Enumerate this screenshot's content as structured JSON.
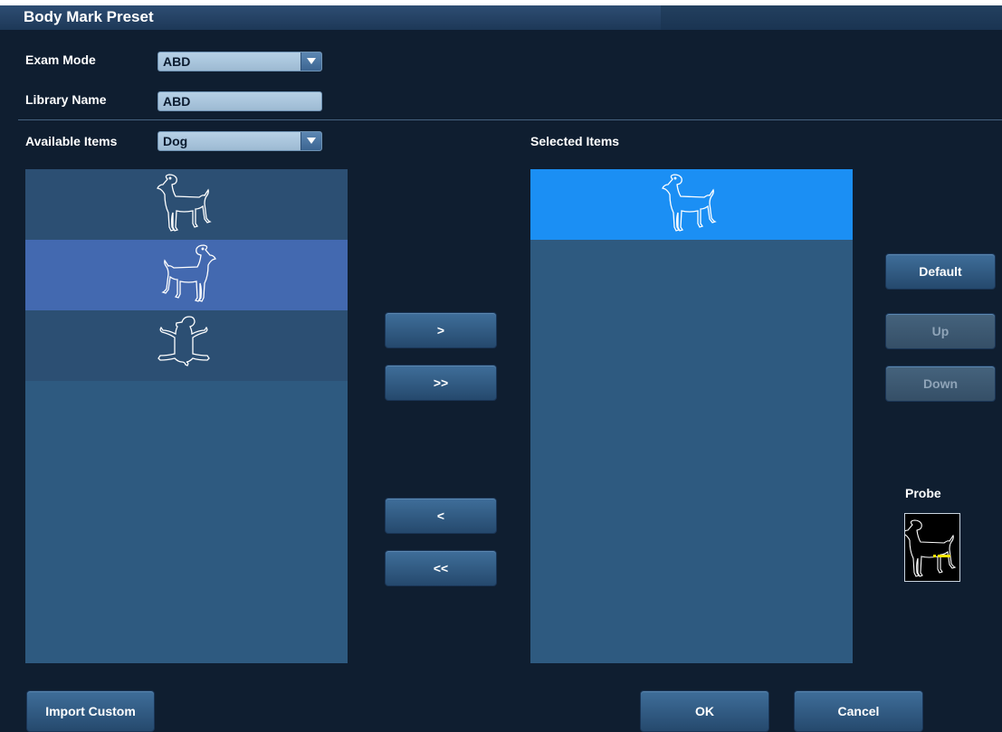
{
  "dialog": {
    "title": "Body Mark Preset"
  },
  "exam_mode": {
    "label": "Exam Mode",
    "value": "ABD"
  },
  "library_name": {
    "label": "Library Name",
    "value": "ABD"
  },
  "available": {
    "label": "Available Items",
    "category": "Dog",
    "items": [
      "dog-standing-right",
      "dog-standing-left",
      "dog-supine"
    ]
  },
  "selected": {
    "label": "Selected Items",
    "items": [
      "dog-standing-right"
    ]
  },
  "transfer": {
    "add": ">",
    "add_all": ">>",
    "remove": "<",
    "remove_all": "<<"
  },
  "order": {
    "default": "Default",
    "up": "Up",
    "down": "Down"
  },
  "probe": {
    "label": "Probe"
  },
  "footer": {
    "import": "Import Custom",
    "ok": "OK",
    "cancel": "Cancel"
  },
  "colors": {
    "background": "#0f1e30",
    "panel": "#2e5a80",
    "item_row": "#2c4f73",
    "item_highlight": "#4369b0",
    "selected_highlight": "#1b8ff4",
    "probe_marker": "#ffe600"
  }
}
